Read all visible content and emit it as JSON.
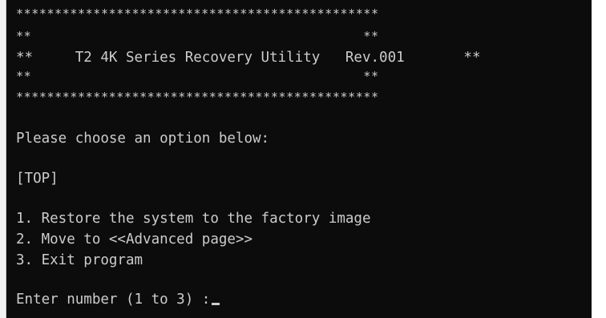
{
  "banner": {
    "border_line": "***********************************************",
    "empty_line": "**                                           **",
    "title_line": "**     T2 4K Series Recovery Utility   Rev.001       **"
  },
  "prompt": {
    "instruction": "Please choose an option below:",
    "page_label": "[TOP]",
    "input_prompt": "Enter number (1 to 3) :"
  },
  "menu": {
    "items": [
      "1. Restore the system to the factory image",
      "2. Move to <<Advanced page>>",
      "3. Exit program"
    ]
  },
  "colors": {
    "background": "#0c0c0c",
    "text": "#cccccc"
  }
}
